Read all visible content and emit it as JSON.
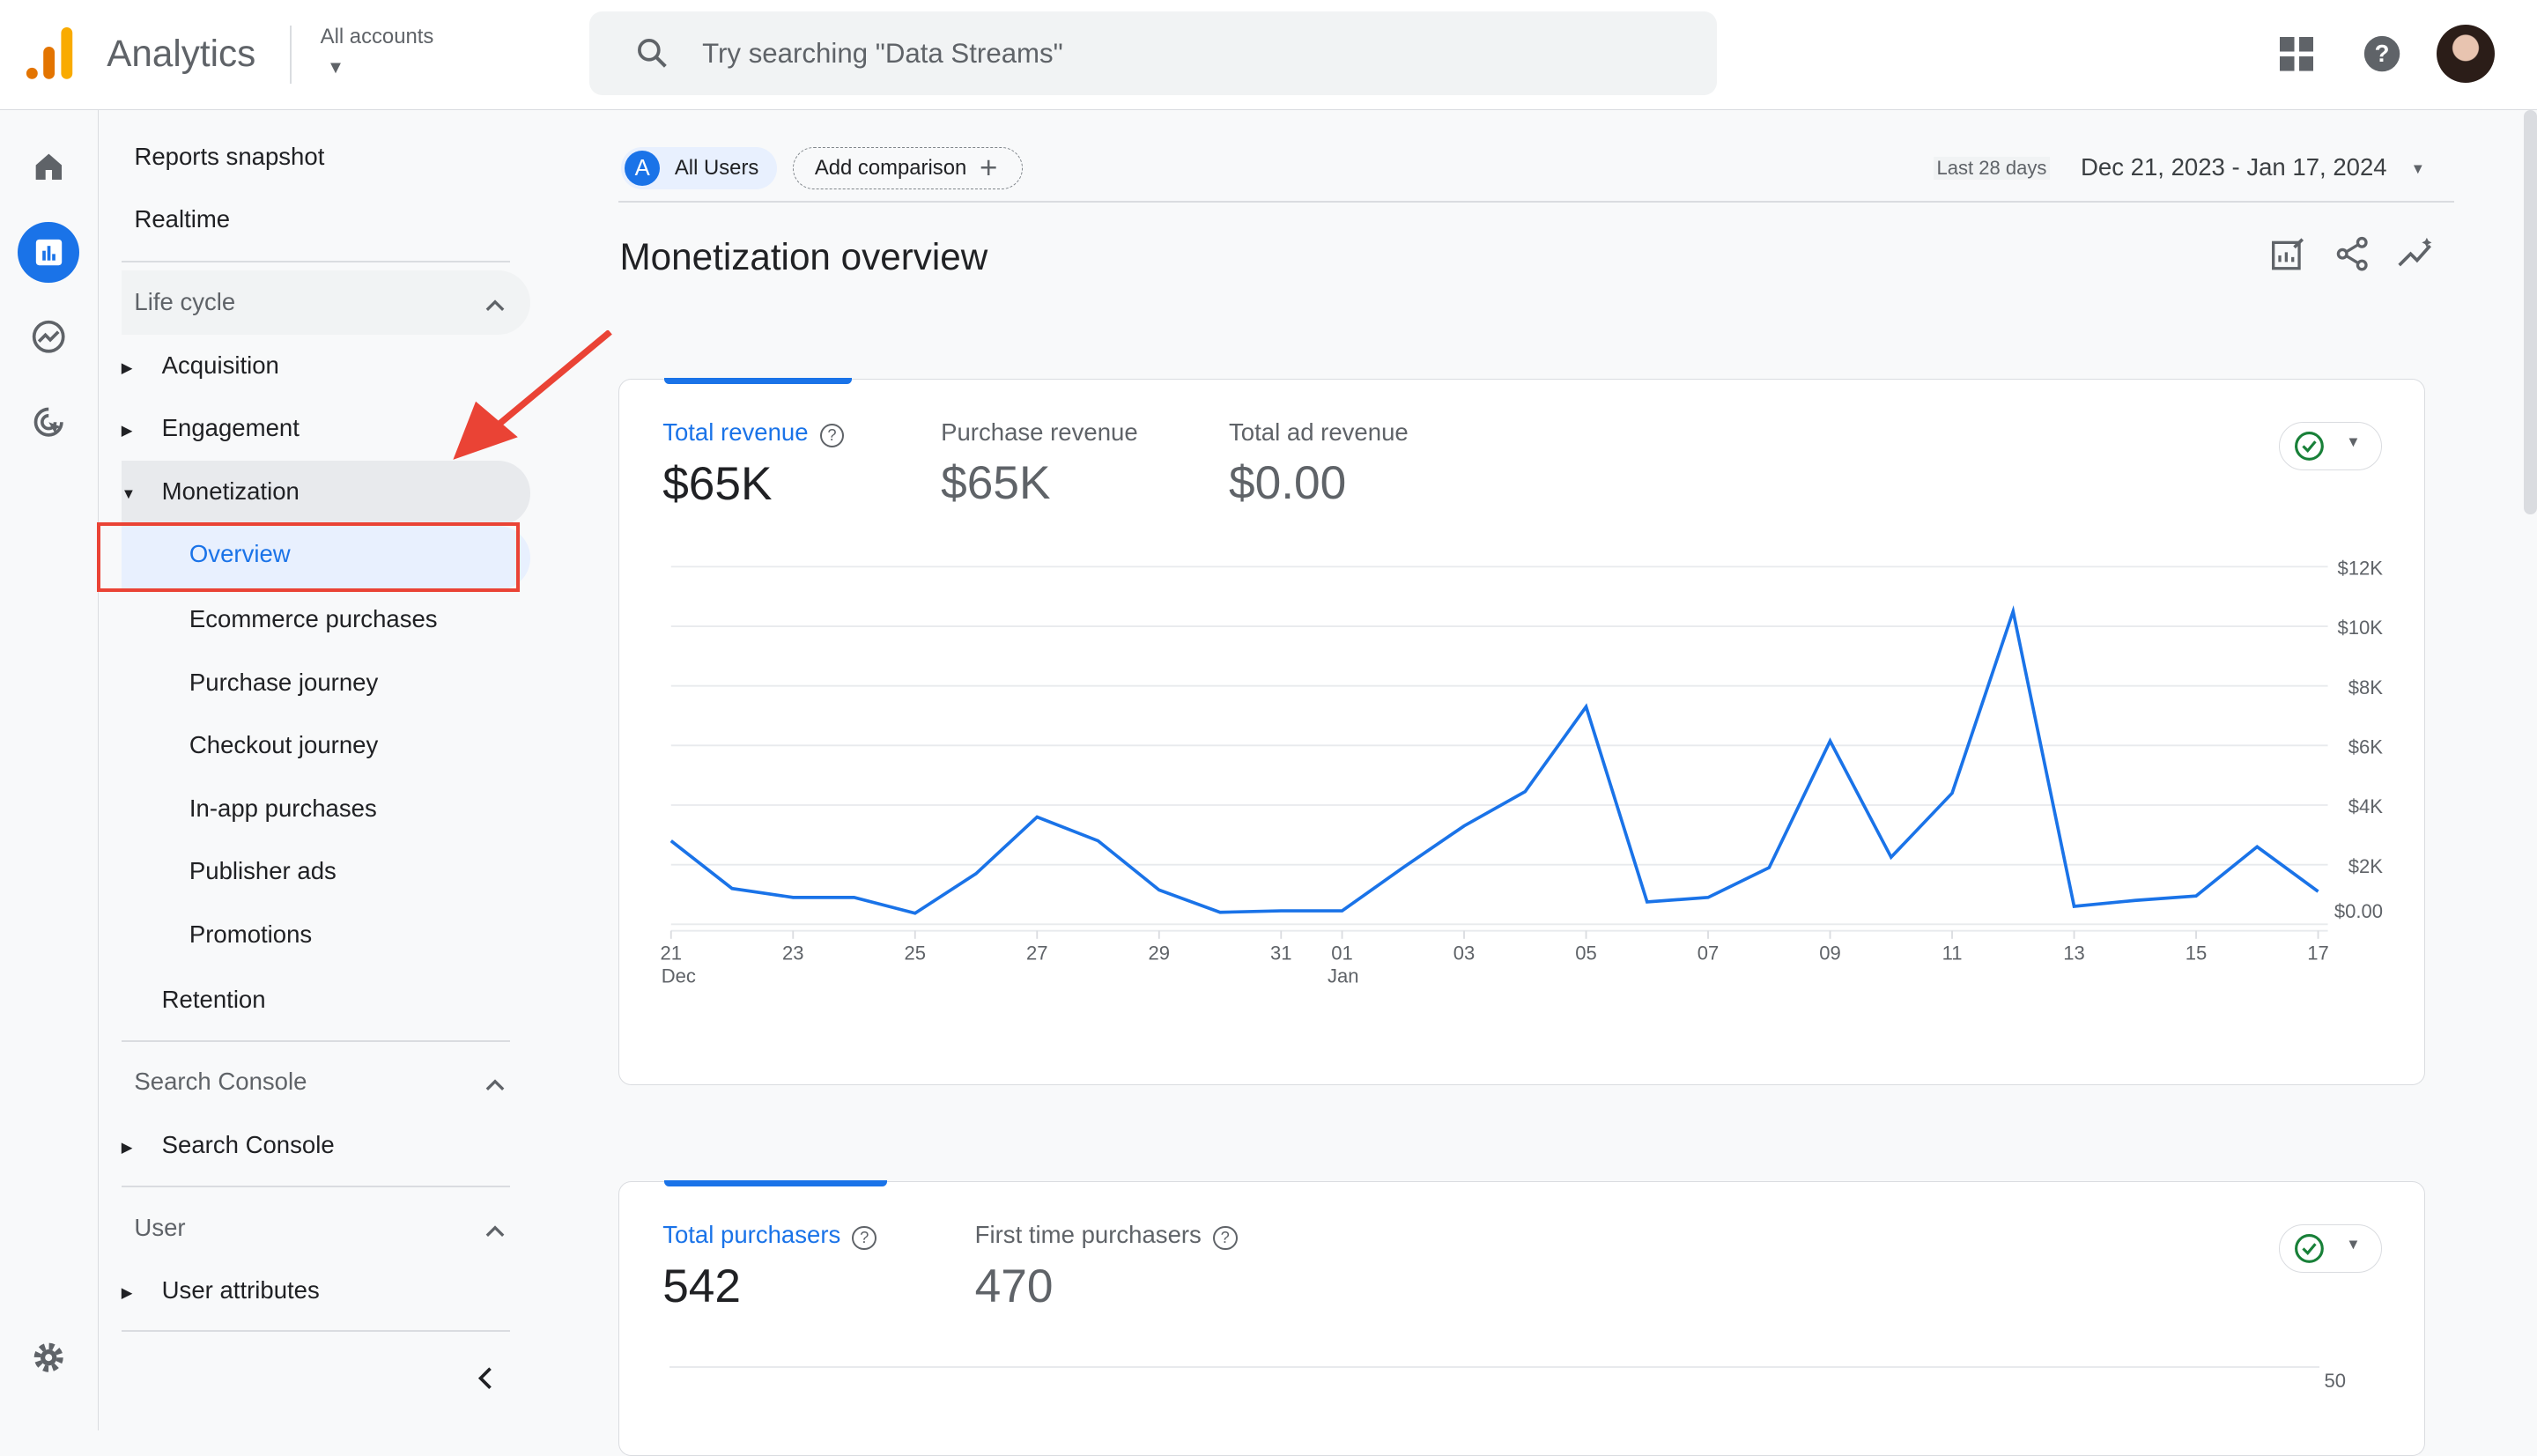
{
  "header": {
    "app_name": "Analytics",
    "account_label": "All accounts",
    "search_placeholder": "Try searching \"Data Streams\""
  },
  "nav": {
    "top_items": [
      "Reports snapshot",
      "Realtime"
    ],
    "lifecycle": {
      "title": "Life cycle",
      "items": [
        "Acquisition",
        "Engagement",
        "Monetization"
      ]
    },
    "monetization_children": [
      "Overview",
      "Ecommerce purchases",
      "Purchase journey",
      "Checkout journey",
      "In-app purchases",
      "Publisher ads",
      "Promotions"
    ],
    "retention": "Retention",
    "search_console": {
      "title": "Search Console",
      "items": [
        "Search Console"
      ]
    },
    "user": {
      "title": "User",
      "items": [
        "User attributes"
      ]
    }
  },
  "toolbar": {
    "segment_letter": "A",
    "segment": "All Users",
    "add_comparison": "Add comparison",
    "date_preset": "Last 28 days",
    "date_range": "Dec 21, 2023 - Jan 17, 2024"
  },
  "page_title": "Monetization overview",
  "revenue_card": {
    "metrics": [
      {
        "label": "Total revenue",
        "value": "$65K"
      },
      {
        "label": "Purchase revenue",
        "value": "$65K"
      },
      {
        "label": "Total ad revenue",
        "value": "$0.00"
      }
    ]
  },
  "purchasers_card": {
    "metrics": [
      {
        "label": "Total purchasers",
        "value": "542"
      },
      {
        "label": "First time purchasers",
        "value": "470"
      }
    ],
    "y_tick_top": "50"
  },
  "colors": {
    "accent": "#1a73e8",
    "highlight": "#ea4335"
  },
  "chart_data": {
    "type": "line",
    "x": [
      "Dec 21",
      "Dec 22",
      "Dec 23",
      "Dec 24",
      "Dec 25",
      "Dec 26",
      "Dec 27",
      "Dec 28",
      "Dec 29",
      "Dec 30",
      "Dec 31",
      "Jan 01",
      "Jan 02",
      "Jan 03",
      "Jan 04",
      "Jan 05",
      "Jan 06",
      "Jan 07",
      "Jan 08",
      "Jan 09",
      "Jan 10",
      "Jan 11",
      "Jan 12",
      "Jan 13",
      "Jan 14",
      "Jan 15",
      "Jan 16",
      "Jan 17"
    ],
    "series": [
      {
        "values": [
          2800,
          1200,
          900,
          900,
          370,
          1700,
          3600,
          2800,
          1150,
          400,
          450,
          450,
          1900,
          3300,
          4450,
          7300,
          750,
          900,
          1900,
          6150,
          2250,
          4400,
          10500,
          600,
          800,
          950,
          2600,
          1100
        ]
      }
    ],
    "ylim": [
      0,
      12000
    ],
    "y_ticks": [
      "$0.00",
      "$2K",
      "$4K",
      "$6K",
      "$8K",
      "$10K",
      "$12K"
    ],
    "x_ticks": [
      "21",
      "23",
      "25",
      "27",
      "29",
      "31",
      "01",
      "03",
      "05",
      "07",
      "09",
      "11",
      "13",
      "15",
      "17"
    ],
    "x_month_labels": [
      "Dec",
      "Jan"
    ],
    "grid": true
  }
}
